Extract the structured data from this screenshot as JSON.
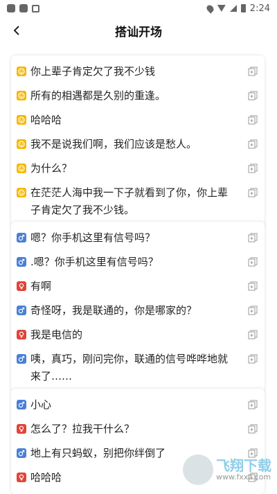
{
  "status": {
    "time": "2:24"
  },
  "header": {
    "title": "搭讪开场"
  },
  "cards": [
    {
      "lines": [
        {
          "kind": "yellow",
          "text": "你上辈子肯定欠了我不少钱"
        },
        {
          "kind": "yellow",
          "text": "所有的相遇都是久别的重逢。"
        },
        {
          "kind": "yellow",
          "text": "哈哈哈"
        },
        {
          "kind": "yellow",
          "text": "我不是说我们啊，我们应该是愁人。"
        },
        {
          "kind": "yellow",
          "text": "为什么？"
        },
        {
          "kind": "yellow",
          "text": "在茫茫人海中我一下子就看到了你，你上辈子肯定欠了我不少钱。"
        }
      ]
    },
    {
      "lines": [
        {
          "kind": "blue",
          "text": "嗯？你手机这里有信号吗？"
        },
        {
          "kind": "blue",
          "text": ".嗯？你手机这里有信号吗？"
        },
        {
          "kind": "red",
          "text": "有啊"
        },
        {
          "kind": "blue",
          "text": "奇怪呀，我是联通的，你是哪家的？"
        },
        {
          "kind": "red",
          "text": "我是电信的"
        },
        {
          "kind": "blue",
          "text": "咦，真巧，刚问完你，联通的信号哗哗地就来了……"
        }
      ]
    },
    {
      "lines": [
        {
          "kind": "blue",
          "text": "小心"
        },
        {
          "kind": "red",
          "text": "怎么了？拉我干什么？"
        },
        {
          "kind": "blue",
          "text": "地上有只蚂蚁，别把你绊倒了"
        },
        {
          "kind": "red",
          "text": "哈哈哈"
        }
      ]
    }
  ],
  "watermark": {
    "big": "飞翔下载",
    "small": "www.fxxz.com"
  }
}
